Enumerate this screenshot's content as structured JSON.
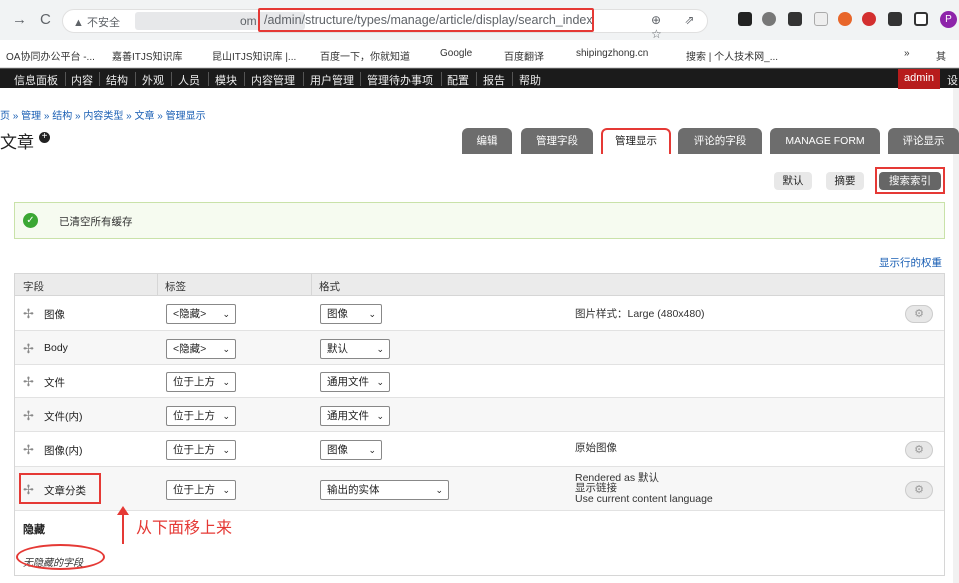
{
  "browser": {
    "nav_back": "→",
    "nav_reload": "C",
    "url_warning": "▲ 不安全",
    "url_prefix": "om",
    "url_path": "/admin/structure/types/manage/article/display/search_index",
    "url_icons": "⊕ ⇗ ☆",
    "profile": "P"
  },
  "bookmarks": [
    "OA协同办公平台 -...",
    "嘉善ITJS知识库",
    "昆山ITJS知识库 |...",
    "百度一下，你就知道",
    "Google",
    "百度翻译",
    "shipingzhong.cn",
    "搜索 | 个人技术网_...",
    "»",
    "其"
  ],
  "admin_menu": {
    "items": [
      "信息面板",
      "内容",
      "结构",
      "外观",
      "人员",
      "模块",
      "内容管理",
      "用户管理",
      "管理待办事项",
      "配置",
      "报告",
      "帮助"
    ],
    "user": "admin",
    "extra": "设"
  },
  "page": {
    "breadcrumb": "页 » 管理 » 结构 » 内容类型 » 文章 » 管理显示",
    "title": "文章",
    "tabs": [
      "编辑",
      "管理字段",
      "管理显示",
      "评论的字段",
      "MANAGE FORM",
      "评论显示"
    ],
    "active_tab": "管理显示",
    "subtabs": [
      "默认",
      "摘要",
      "搜索索引"
    ],
    "active_subtab": "搜索索引",
    "status_message": "已清空所有缓存",
    "row_weights_link": "显示行的权重"
  },
  "table": {
    "headers": [
      "字段",
      "标签",
      "格式"
    ],
    "rows": [
      {
        "field": "图像",
        "label": "<隐藏>",
        "format": "图像",
        "summary": [
          "图片样式：Large (480x480)"
        ],
        "has_gear": true
      },
      {
        "field": "Body",
        "label": "<隐藏>",
        "format": "默认",
        "summary": [],
        "has_gear": false
      },
      {
        "field": "文件",
        "label": "位于上方",
        "format": "通用文件",
        "summary": [],
        "has_gear": false
      },
      {
        "field": "文件(内)",
        "label": "位于上方",
        "format": "通用文件",
        "summary": [],
        "has_gear": false
      },
      {
        "field": "图像(内)",
        "label": "位于上方",
        "format": "图像",
        "summary": [
          "原始图像"
        ],
        "has_gear": true
      },
      {
        "field": "文章分类",
        "label": "位于上方",
        "format": "输出的实体",
        "summary": [
          "Rendered as 默认",
          "显示链接",
          "Use current content language"
        ],
        "has_gear": true
      }
    ],
    "hidden_section_title": "隐藏",
    "no_hidden_fields": "无隐藏的字段"
  },
  "annotation": {
    "text": "从下面移上来"
  }
}
